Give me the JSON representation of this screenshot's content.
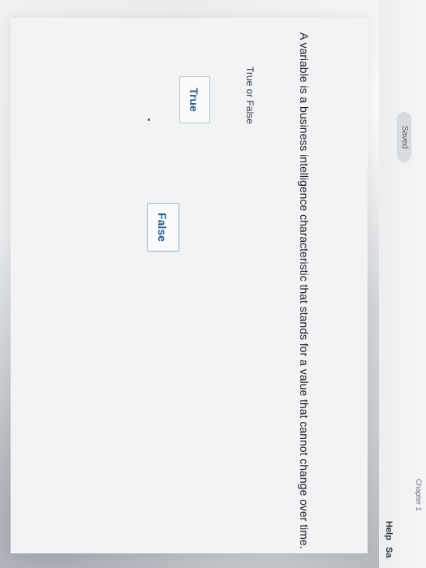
{
  "header": {
    "chapter": "Chapter 1",
    "saved": "Saved",
    "help": "Help",
    "save_partial": "Sa"
  },
  "question": {
    "prompt": "A variable is a business intelligence characteristic that stands for a value that cannot change over time.",
    "type_label": "True or False",
    "options": [
      "True",
      "False"
    ]
  }
}
